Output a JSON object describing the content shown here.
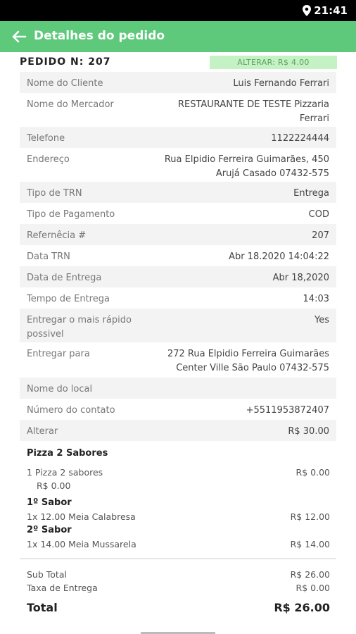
{
  "status_bar": {
    "time": "21:41",
    "icon": "location-pin-icon"
  },
  "header": {
    "title": "Detalhes do pedido",
    "back_icon": "arrow-left-icon",
    "color": "#5ec97a"
  },
  "order": {
    "number_label": "PEDIDO N: 207",
    "alter_label": "ALTERAR: R$ 4.00"
  },
  "details": [
    {
      "label": "Nome do Cliente",
      "value": "Luis Fernando Ferrari"
    },
    {
      "label": "Nome do Mercador",
      "value": "RESTAURANTE DE TESTE Pizzaria Ferrari"
    },
    {
      "label": "Telefone",
      "value": "1122224444"
    },
    {
      "label": "Endereço",
      "value": "Rua Elpidio Ferreira Guimarães, 450 Arujá Casado 07432-575"
    },
    {
      "label": "Tipo de TRN",
      "value": "Entrega"
    },
    {
      "label": "Tipo de Pagamento",
      "value": "COD"
    },
    {
      "label": "Refernêcia #",
      "value": "207"
    },
    {
      "label": "Data TRN",
      "value": "Abr 18.2020 14:04:22"
    },
    {
      "label": "Data de Entrega",
      "value": "Abr 18,2020"
    },
    {
      "label": "Tempo de Entrega",
      "value": "14:03"
    },
    {
      "label": "Entregar o mais rápido possivel",
      "value": "Yes"
    },
    {
      "label": "Entregar para",
      "value": "272 Rua Elpidio Ferreira Guimarães Center Ville São Paulo 07432-575"
    },
    {
      "label": "Nome do local",
      "value": ""
    },
    {
      "label": "Número do contato",
      "value": "+5511953872407"
    },
    {
      "label": "Alterar",
      "value": "R$ 30.00"
    }
  ],
  "items": {
    "title": "Pizza 2 Sabores",
    "line1": "1  Pizza 2 sabores",
    "line1_sub": "R$ 0.00",
    "line1_price": "R$ 0.00",
    "sabor1_title": "1º Sabor",
    "sabor1_line": "1x  12.00 Meia Calabresa",
    "sabor1_price": "R$ 12.00",
    "sabor2_title": "2º Sabor",
    "sabor2_line": "1x  14.00 Meia Mussarela",
    "sabor2_price": "R$ 14.00"
  },
  "totals": {
    "subtotal_label": "Sub Total",
    "subtotal_value": "R$ 26.00",
    "delivery_label": "Taxa de Entrega",
    "delivery_value": "R$ 0.00",
    "total_label": "Total",
    "total_value": "R$ 26.00"
  }
}
